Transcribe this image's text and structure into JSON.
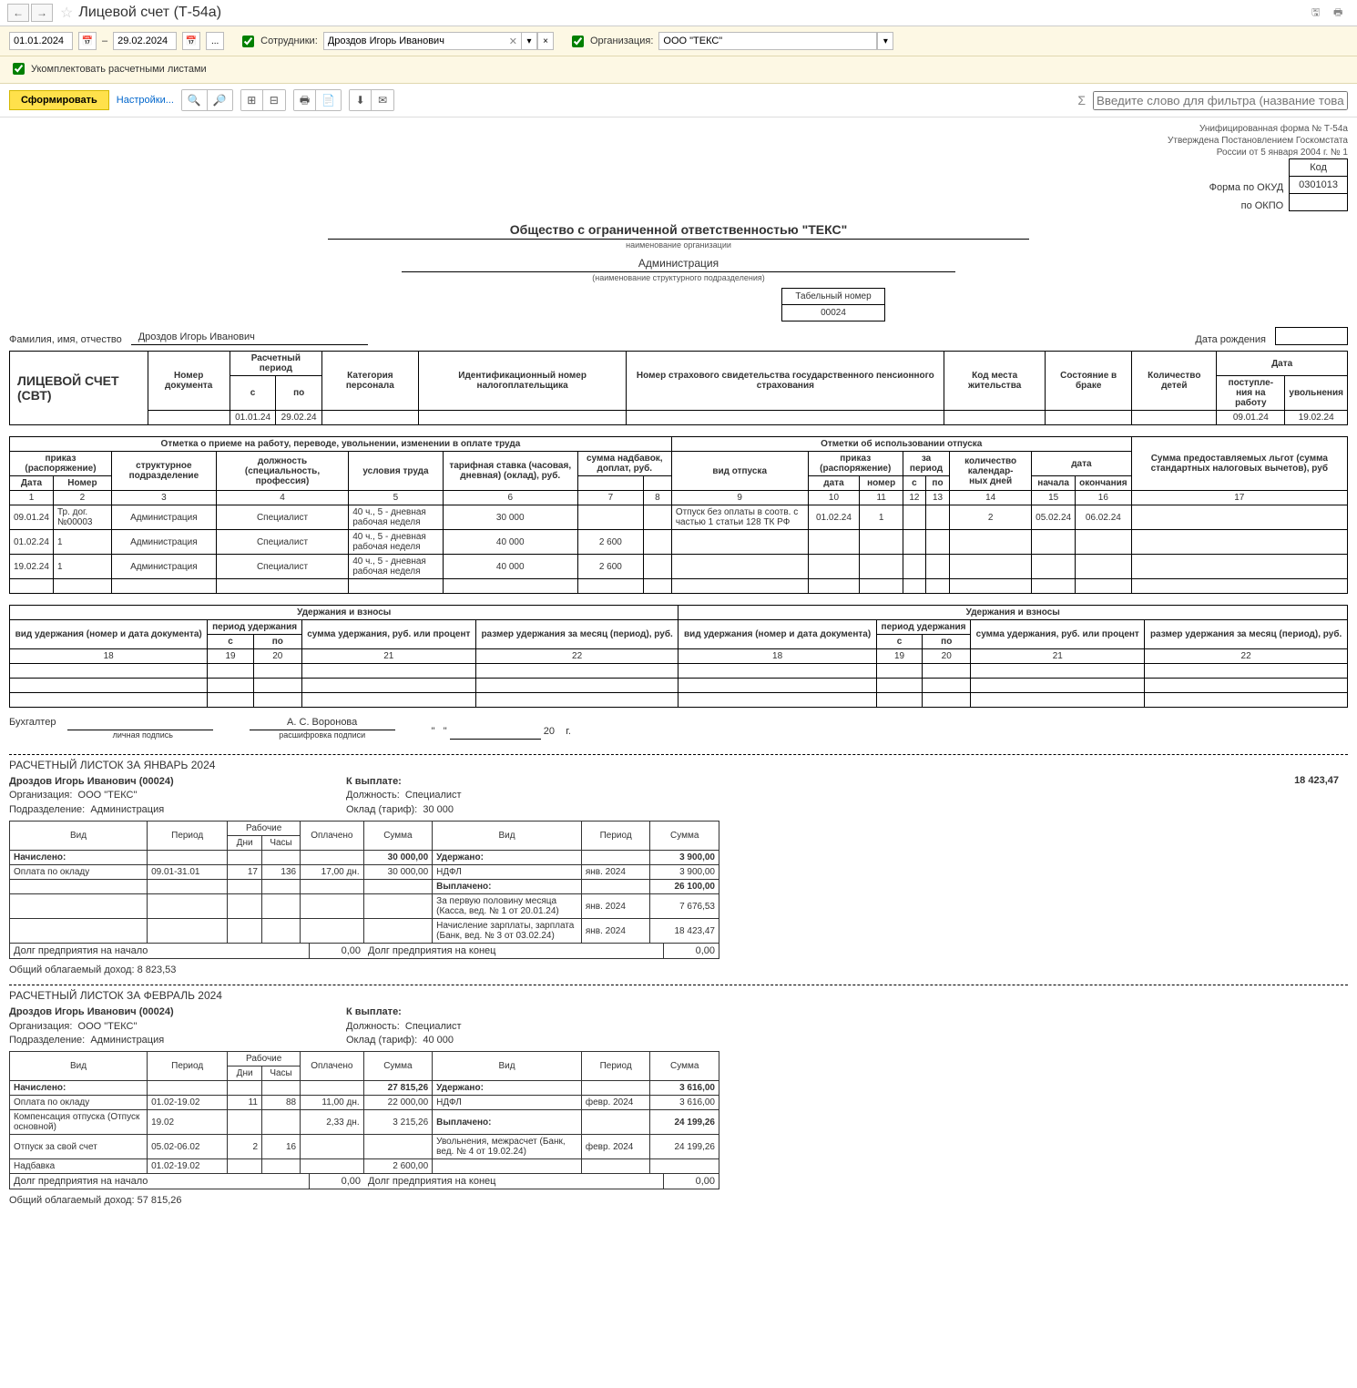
{
  "title": "Лицевой счет (Т-54а)",
  "filters": {
    "date_from": "01.01.2024",
    "date_to": "29.02.2024",
    "employees_label": "Сотрудники:",
    "employee_value": "Дроздов Игорь Иванович",
    "org_label": "Организация:",
    "org_value": "ООО \"ТЕКС\"",
    "complete_label": "Укомплектовать расчетными листами"
  },
  "actions": {
    "generate": "Сформировать",
    "settings": "Настройки...",
    "filter_placeholder": "Введите слово для фильтра (название товара, покупат"
  },
  "docheader": {
    "form_note1": "Унифицированная форма № Т-54а",
    "form_note2": "Утверждена Постановлением Госкомстата",
    "form_note3": "России от 5 января 2004 г. № 1",
    "code_label": "Код",
    "okud_label": "Форма по ОКУД",
    "okud_value": "0301013",
    "okpo_label": "по ОКПО",
    "org_name": "Общество с ограниченной ответственностью \"ТЕКС\"",
    "org_caption": "наименование организации",
    "dept_name": "Администрация",
    "dept_caption": "(наименование структурного подразделения)",
    "tabel_label": "Табельный номер",
    "tabel_value": "00024",
    "fio_label": "Фамилия, имя, отчество",
    "fio_value": "Дроздов Игорь Иванович",
    "dob_label": "Дата рождения",
    "doc_title": "ЛИЦЕВОЙ СЧЕТ (СВТ)"
  },
  "mainhead": {
    "doc_num": "Номер документа",
    "period": "Расчетный период",
    "period_s": "с",
    "period_po": "по",
    "cat": "Категория персонала",
    "inn": "Идентификационный номер налогоплательщика",
    "snils": "Номер страхового свидетельства государственного пенсионного страхования",
    "place": "Код места жительства",
    "marital": "Состояние в браке",
    "children": "Количество детей",
    "date": "Дата",
    "date_in": "поступле-\nния на работу",
    "date_out": "увольнения",
    "val_s": "01.01.24",
    "val_po": "29.02.24",
    "val_in": "09.01.24",
    "val_out": "19.02.24"
  },
  "work": {
    "h1": "Отметка о приеме на работу, переводе, увольнении, изменении в оплате труда",
    "h2": "Отметки об использовании отпуска",
    "order": "приказ (распоряжение)",
    "date": "Дата",
    "num": "Номер",
    "dept": "структурное подразделение",
    "pos": "должность (специальность, профессия)",
    "cond": "условия труда",
    "rate": "тарифная ставка (часовая, дневная) (оклад), руб.",
    "add": "сумма надбавок, доплат, руб.",
    "vac_type": "вид отпуска",
    "vac_order": "приказ (распоряжение)",
    "vac_date": "дата",
    "vac_num": "номер",
    "vac_period": "за период",
    "vac_s": "с",
    "vac_po": "по",
    "vac_days": "количество календар-\nных дней",
    "vac_dates": "дата",
    "vac_start": "начала",
    "vac_end": "окончания",
    "benefits": "Сумма предоставляемых льгот (сумма стандартных налоговых вычетов), руб",
    "cols": [
      "1",
      "2",
      "3",
      "4",
      "5",
      "6",
      "7",
      "8",
      "9",
      "10",
      "11",
      "12",
      "13",
      "14",
      "15",
      "16",
      "17"
    ],
    "rows": [
      {
        "d": "09.01.24",
        "n": "Тр. дог. №00003",
        "dept": "Администрация",
        "pos": "Специалист",
        "cond": "40 ч., 5 - дневная рабочая неделя",
        "rate": "30 000",
        "add": "",
        "vt": "Отпуск без оплаты в соотв. с частью 1 статьи 128 ТК РФ",
        "vd": "01.02.24",
        "vn": "1",
        "vs": "",
        "vp": "",
        "days": "2",
        "dstart": "05.02.24",
        "dend": "06.02.24",
        "ben": ""
      },
      {
        "d": "01.02.24",
        "n": "1",
        "dept": "Администрация",
        "pos": "Специалист",
        "cond": "40 ч., 5 - дневная рабочая неделя",
        "rate": "40 000",
        "add": "2 600",
        "vt": "",
        "vd": "",
        "vn": "",
        "vs": "",
        "vp": "",
        "days": "",
        "dstart": "",
        "dend": "",
        "ben": ""
      },
      {
        "d": "19.02.24",
        "n": "1",
        "dept": "Администрация",
        "pos": "Специалист",
        "cond": "40 ч., 5 - дневная рабочая неделя",
        "rate": "40 000",
        "add": "2 600",
        "vt": "",
        "vd": "",
        "vn": "",
        "vs": "",
        "vp": "",
        "days": "",
        "dstart": "",
        "dend": "",
        "ben": ""
      }
    ]
  },
  "ded": {
    "title": "Удержания и взносы",
    "type": "вид удержания (номер и дата документа)",
    "period": "период удержания",
    "s": "с",
    "po": "по",
    "sum": "сумма удержания, руб. или процент",
    "mon": "размер удержания за месяц (период), руб.",
    "cols": [
      "18",
      "19",
      "20",
      "21",
      "22",
      "18",
      "19",
      "20",
      "21",
      "22"
    ]
  },
  "sign": {
    "role": "Бухгалтер",
    "p1": "личная подпись",
    "name": "А. С. Воронова",
    "p2": "расшифровка подписи",
    "year": "20",
    "g": "г."
  },
  "slip1": {
    "title": "РАСЧЕТНЫЙ ЛИСТОК ЗА ЯНВАРЬ 2024",
    "emp": "Дроздов Игорь Иванович (00024)",
    "org_l": "Организация:",
    "org_v": "ООО \"ТЕКС\"",
    "dept_l": "Подразделение:",
    "dept_v": "Администрация",
    "pay_l": "К выплате:",
    "pay_v": "18 423,47",
    "pos_l": "Должность:",
    "pos_v": "Специалист",
    "rate_l": "Оклад (тариф):",
    "rate_v": "30 000",
    "h": {
      "vid": "Вид",
      "period": "Период",
      "work": "Рабочие",
      "dni": "Дни",
      "chasy": "Часы",
      "paid": "Оплачено",
      "sum": "Сумма"
    },
    "accrued_l": "Начислено:",
    "accrued_v": "30 000,00",
    "withheld_l": "Удержано:",
    "withheld_v": "3 900,00",
    "paid_l": "Выплачено:",
    "paid_v": "26 100,00",
    "r1": {
      "name": "Оплата по окладу",
      "period": "09.01-31.01",
      "dni": "17",
      "chasy": "136",
      "paid": "17,00 дн.",
      "sum": "30 000,00"
    },
    "r2": {
      "name": "НДФЛ",
      "period": "янв. 2024",
      "sum": "3 900,00"
    },
    "r3": {
      "name": "За первую половину месяца (Касса, вед. № 1 от 20.01.24)",
      "period": "янв. 2024",
      "sum": "7 676,53"
    },
    "r4": {
      "name": "Начисление зарплаты, зарплата (Банк, вед. № 3 от 03.02.24)",
      "period": "янв. 2024",
      "sum": "18 423,47"
    },
    "debt_start_l": "Долг предприятия на начало",
    "debt_start_v": "0,00",
    "debt_end_l": "Долг предприятия на конец",
    "debt_end_v": "0,00",
    "income": "Общий облагаемый доход: 8 823,53"
  },
  "slip2": {
    "title": "РАСЧЕТНЫЙ ЛИСТОК ЗА ФЕВРАЛЬ 2024",
    "emp": "Дроздов Игорь Иванович (00024)",
    "org_l": "Организация:",
    "org_v": "ООО \"ТЕКС\"",
    "dept_l": "Подразделение:",
    "dept_v": "Администрация",
    "pay_l": "К выплате:",
    "pos_l": "Должность:",
    "pos_v": "Специалист",
    "rate_l": "Оклад (тариф):",
    "rate_v": "40 000",
    "accrued_l": "Начислено:",
    "accrued_v": "27 815,26",
    "withheld_l": "Удержано:",
    "withheld_v": "3 616,00",
    "paid_l": "Выплачено:",
    "paid_v": "24 199,26",
    "r1": {
      "name": "Оплата по окладу",
      "period": "01.02-19.02",
      "dni": "11",
      "chasy": "88",
      "paid": "11,00 дн.",
      "sum": "22 000,00"
    },
    "r2": {
      "name": "НДФЛ",
      "period": "февр. 2024",
      "sum": "3 616,00"
    },
    "r3": {
      "name": "Компенсация отпуска (Отпуск основной)",
      "period": "19.02",
      "paid": "2,33 дн.",
      "sum": "3 215,26"
    },
    "r4": {
      "name": "Увольнения, межрасчет (Банк, вед. № 4 от 19.02.24)",
      "period": "февр. 2024",
      "sum": "24 199,26"
    },
    "r5": {
      "name": "Отпуск за свой счет",
      "period": "05.02-06.02",
      "dni": "2",
      "chasy": "16"
    },
    "r6": {
      "name": "Надбавка",
      "period": "01.02-19.02",
      "sum": "2 600,00"
    },
    "debt_start_l": "Долг предприятия на начало",
    "debt_start_v": "0,00",
    "debt_end_l": "Долг предприятия на конец",
    "debt_end_v": "0,00",
    "income": "Общий облагаемый доход: 57 815,26"
  }
}
